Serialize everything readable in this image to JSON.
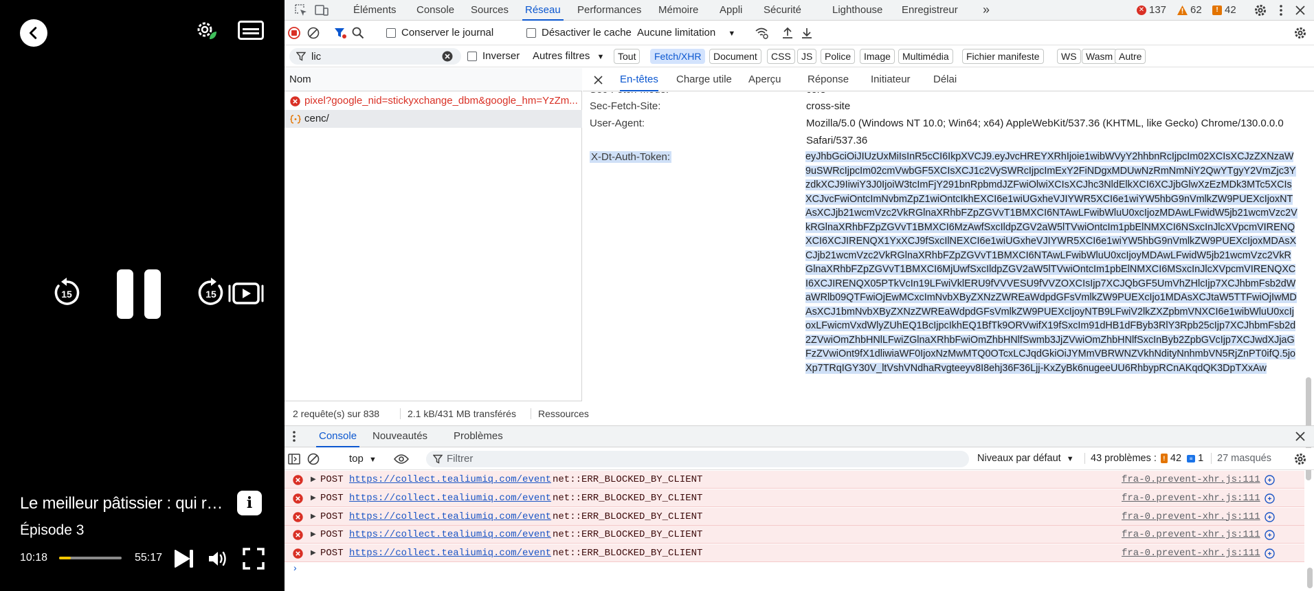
{
  "player": {
    "title": "Le meilleur pâtissier : qui ré...",
    "episode": "Épisode 3",
    "current_time": "10:18",
    "total_time": "55:17",
    "progress_fraction": 0.19,
    "skip_seconds": "15",
    "accent_color": "#f7c600"
  },
  "devtools": {
    "tabs": [
      "Éléments",
      "Console",
      "Sources",
      "Réseau",
      "Performances",
      "Mémoire",
      "Appli",
      "Sécurité",
      "Lighthouse",
      "Enregistreur"
    ],
    "active_tab": "Réseau",
    "more_tabs_icon": "»",
    "counts": {
      "errors": "137",
      "warnings": "62",
      "issues": "42"
    },
    "toolbar": {
      "preserve_log": "Conserver le journal",
      "disable_cache": "Désactiver le cache",
      "throttling": "Aucune limitation"
    },
    "filter": {
      "value": "lic",
      "invert": "Inverser",
      "more_filters": "Autres filtres",
      "chips": [
        "Tout",
        "Fetch/XHR",
        "Document",
        "CSS",
        "JS",
        "Police",
        "Image",
        "Multimédia",
        "Fichier manifeste",
        "WS",
        "Wasm",
        "Autre"
      ],
      "active_chip": "Fetch/XHR"
    },
    "requests": {
      "column_name": "Nom",
      "rows": [
        {
          "name": "pixel?google_nid=stickyxchange_dbm&google_hm=YzZm...",
          "status": "error"
        },
        {
          "name": "cenc/",
          "status": "xhr"
        }
      ],
      "status_bar": {
        "count": "2 requête(s) sur 838",
        "transfer": "2.1 kB/431 MB transférés",
        "resources": "Ressources"
      }
    },
    "details": {
      "tabs": [
        "En-têtes",
        "Charge utile",
        "Aperçu",
        "Réponse",
        "Initiateur",
        "Délai"
      ],
      "active_tab": "En-têtes",
      "partial_header": {
        "key": "Sec-Fetch-Mode:",
        "value": "cors"
      },
      "headers": [
        {
          "key": "Sec-Fetch-Site:",
          "value": "cross-site"
        },
        {
          "key": "User-Agent:",
          "value": "Mozilla/5.0 (Windows NT 10.0; Win64; x64) AppleWebKit/537.36 (KHTML, like Gecko) Chrome/130.0.0.0 Safari/537.36"
        }
      ],
      "token_key": "X-Dt-Auth-Token:",
      "token_value": "eyJhbGciOiJIUzUxMiIsInR5cCI6IkpXVCJ9.eyJvcHREYXRhIjoie1wibWVyY2hhbnRcIjpcIm02XCIsXCJzZXNzaW9uSWRcIjpcIm02cmVwbGF5XCIsXCJ1c2VySWRcIjpcImExY2FiNDgxMDUwNzRmNmNiY2QwYTgyY2VmZjc3YzdkXCJ9IiwiY3J0IjoiW3tcImFjY291bnRpbmdJZFwiOlwiXCIsXCJhc3NldElkXCI6XCJjbGlwXzEzMDk3MTc5XCIsXCJvcFwiOntcImNvbmZpZ1wiOntcIkhEXCI6e1wiUGxheVJIYWR5XCI6e1wiYW5hbG9nVmlkZW9PUEXcIjoxNTAsXCJjb21wcmVzc2VkRGlnaXRhbFZpZGVvT1BMXCI6NTAwLFwibWluU0xcIjozMDAwLFwidW5jb21wcmVzc2VkRGlnaXRhbFZpZGVvT1BMXCI6MzAwfSxcIldpZGV2aW5lTVwiOntcIm1pbElNMXCI6NSxcInJlcXVpcmVIRENQXCI6XCJIRENQX1YxXCJ9fSxcIlNEXCI6e1wiUGxheVJIYWR5XCI6e1wiYW5hbG9nVmlkZW9PUEXcIjoxMDAsXCJjb21wcmVzc2VkRGlnaXRhbFZpZGVvT1BMXCI6NTAwLFwibWluU0xcIjoyMDAwLFwidW5jb21wcmVzc2VkRGlnaXRhbFZpZGVvT1BMXCI6MjUwfSxcIldpZGV2aW5lTVwiOntcIm1pbElNMXCI6MSxcInJlcXVpcmVIRENQXCI6XCJIRENQX05PTkVcIn19LFwiVklERU9fVVVESU9fVVZOXCIsIjp7XCJQbGF5UmVhZHlcIjp7XCJhbmFsb2dWaWRlb09QTFwiOjEwMCxcImNvbXByZXNzZWREaWdpdGFsVmlkZW9PUEXcIjo1MDAsXCJtaW5TTFwiOjIwMDAsXCJ1bmNvbXByZXNzZWREaWdpdGFsVmlkZW9PUEXcIjoyNTB9LFwiV2lkZXZpbmVNXCI6e1wibWluU0xcIjoxLFwicmVxdWlyZUhEQ1BcIjpcIkhEQ1BfTk9ORVwifX19fSxcIm91dHB1dFByb3RlY3Rpb25cIjp7XCJhbmFsb2d2ZVwiOmZhbHNlLFwiZGlnaXRhbFwiOmZhbHNlfSwmb3JjZVwiOmZhbHNlfSxcInByb2ZpbGVcIjp7XCJwdXJjaGFzZVwiOnt9fX1dliwiaWF0IjoxNzMwMTQ0OTcxLCJqdGkiOiJYMmVBRWNZVkhNdityNnhmbVN5RjZnPT0ifQ.5joXp7TRqIGY30V_ltVshVNdhaRvgteeyv8I8ehj36F36Ljj-KxZyBk6nugeeUU6RhbypRCnAKqdQK3DpTXxAw"
    },
    "drawer": {
      "tabs": [
        "Console",
        "Nouveautés",
        "Problèmes"
      ],
      "active_tab": "Console",
      "context": "top",
      "filter_placeholder": "Filtrer",
      "levels": "Niveaux par défaut",
      "problems_label": "43 problèmes :",
      "problems_warn": "42",
      "problems_info": "1",
      "hidden": "27 masqués",
      "logs": [
        {
          "method": "POST",
          "url": "https://collect.tealiumiq.com/event",
          "error": "net::ERR_BLOCKED_BY_CLIENT",
          "source": "fra-0.prevent-xhr.js:111"
        },
        {
          "method": "POST",
          "url": "https://collect.tealiumiq.com/event",
          "error": "net::ERR_BLOCKED_BY_CLIENT",
          "source": "fra-0.prevent-xhr.js:111"
        },
        {
          "method": "POST",
          "url": "https://collect.tealiumiq.com/event",
          "error": "net::ERR_BLOCKED_BY_CLIENT",
          "source": "fra-0.prevent-xhr.js:111"
        },
        {
          "method": "POST",
          "url": "https://collect.tealiumiq.com/event",
          "error": "net::ERR_BLOCKED_BY_CLIENT",
          "source": "fra-0.prevent-xhr.js:111"
        },
        {
          "method": "POST",
          "url": "https://collect.tealiumiq.com/event",
          "error": "net::ERR_BLOCKED_BY_CLIENT",
          "source": "fra-0.prevent-xhr.js:111"
        }
      ]
    },
    "colors": {
      "accent": "#0b57d0",
      "error": "#d93025",
      "warning": "#e37400"
    }
  }
}
